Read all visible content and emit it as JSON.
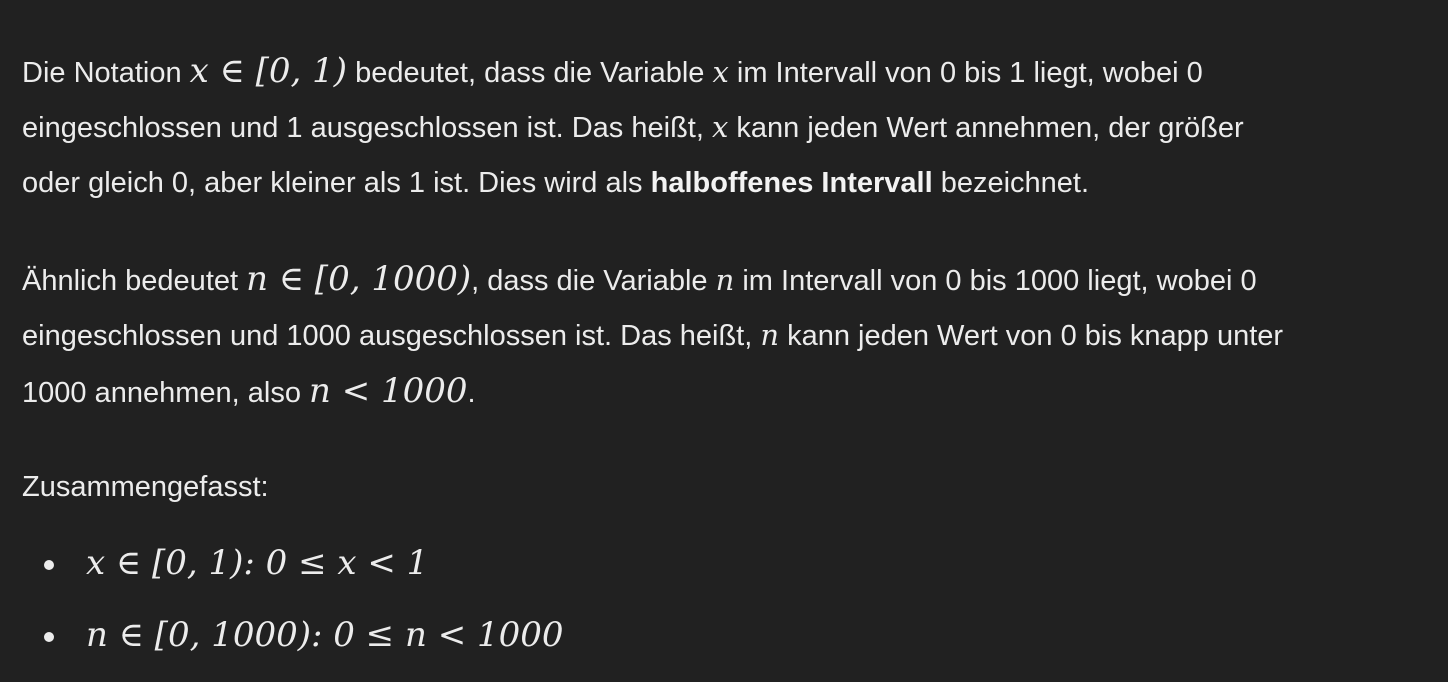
{
  "paragraph1": {
    "line1": {
      "pre": "Die Notation ",
      "math": "x ∈ [0, 1)",
      "post": " bedeutet, dass die Variable ",
      "var": "x",
      "post2": " im Intervall von 0 bis 1 liegt, wobei 0"
    },
    "line2": {
      "pre": "eingeschlossen und 1 ausgeschlossen ist. Das heißt, ",
      "var": "x",
      "post": " kann jeden Wert annehmen, der größer"
    },
    "line3": {
      "pre": "oder gleich 0, aber kleiner als 1 ist. Dies wird als ",
      "bold": "halboffenes Intervall",
      "post": " bezeichnet."
    }
  },
  "paragraph2": {
    "line1": {
      "pre": "Ähnlich bedeutet ",
      "math": "n ∈ [0, 1000)",
      "post": ", dass die Variable ",
      "var": "n",
      "post2": " im Intervall von 0 bis 1000 liegt, wobei 0"
    },
    "line2": {
      "pre": "eingeschlossen und 1000 ausgeschlossen ist. Das heißt, ",
      "var": "n",
      "post": " kann jeden Wert von 0 bis knapp unter"
    },
    "line3": {
      "pre": "1000 annehmen, also ",
      "math": "n < 1000",
      "post": "."
    }
  },
  "summary": {
    "label": "Zusammengefasst:",
    "items": [
      {
        "math": "x ∈ [0, 1): 0 ≤ x < 1"
      },
      {
        "math": "n ∈ [0, 1000): 0 ≤ n < 1000"
      }
    ]
  }
}
